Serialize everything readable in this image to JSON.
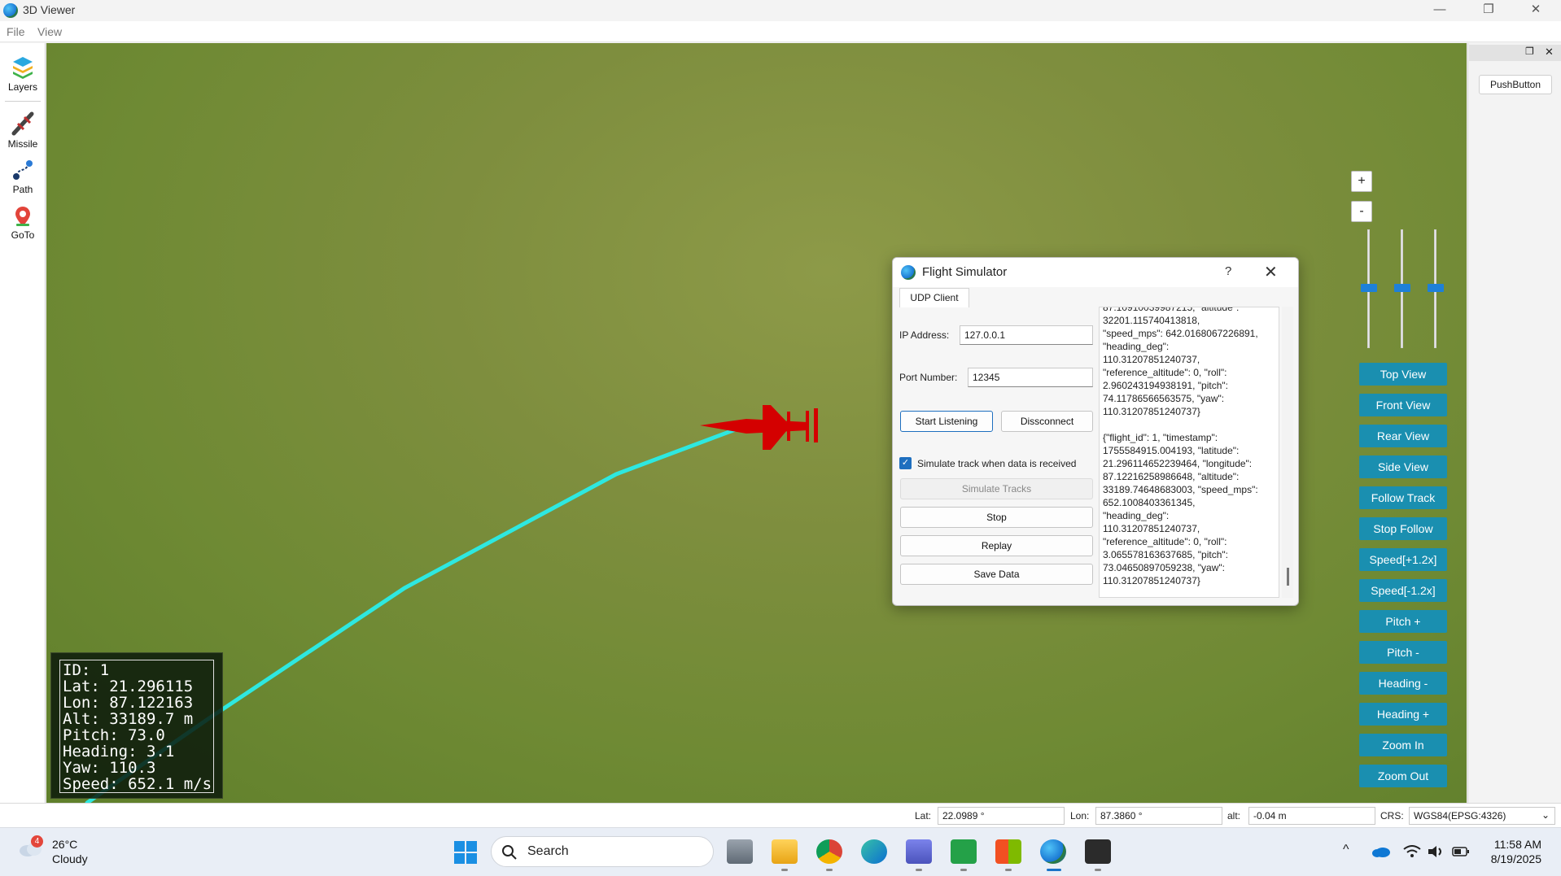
{
  "window": {
    "title": "3D Viewer",
    "minimize": "—",
    "restore": "❐",
    "close": "✕"
  },
  "menu": {
    "file": "File",
    "view": "View"
  },
  "tools": [
    {
      "label": "Layers",
      "icon": "layers-icon"
    },
    {
      "label": "Missile",
      "icon": "missile-icon"
    },
    {
      "label": "Path",
      "icon": "path-icon"
    },
    {
      "label": "GoTo",
      "icon": "goto-pin-icon"
    }
  ],
  "hud": {
    "lines": [
      "ID: 1",
      "Lat: 21.296115",
      "Lon: 87.122163",
      "Alt: 33189.7 m",
      "Pitch: 73.0",
      "Heading: 3.1",
      "Yaw: 110.3",
      "Speed: 652.1 m/s"
    ]
  },
  "dock": {
    "restore": "❐",
    "close": "✕",
    "push_button": "PushButton"
  },
  "zoom": {
    "plus": "+",
    "minus": "-"
  },
  "view_buttons": [
    "Top View",
    "Front View",
    "Rear View",
    "Side View",
    "Follow Track",
    "Stop Follow",
    "Speed[+1.2x]",
    "Speed[-1.2x]",
    "Pitch +",
    "Pitch -",
    "Heading -",
    "Heading +",
    "Zoom In",
    "Zoom Out"
  ],
  "dialog": {
    "title": "Flight Simulator",
    "help": "?",
    "close": "✕",
    "tab": "UDP Client",
    "ip_label": "IP Address:",
    "ip_value": "127.0.0.1",
    "port_label": "Port Number:",
    "port_value": "12345",
    "start_label": "Start Listening",
    "disconnect_label": "Dissconnect",
    "simulate_check_label": "Simulate track when data is received",
    "simulate_check_mark": "✓",
    "simulate_tracks_label": "Simulate Tracks",
    "stop_label": "Stop",
    "replay_label": "Replay",
    "save_label": "Save Data",
    "log_text": "87.10910039987215, \"altitude\":\n32201.115740413818,\n\"speed_mps\": 642.0168067226891,\n\"heading_deg\":\n110.31207851240737,\n\"reference_altitude\": 0, \"roll\":\n2.960243194938191, \"pitch\":\n74.11786566563575, \"yaw\":\n110.31207851240737}\n\n{\"flight_id\": 1, \"timestamp\":\n1755584915.004193, \"latitude\":\n21.296114652239464, \"longitude\":\n87.12216258986648, \"altitude\":\n33189.74648683003, \"speed_mps\":\n652.1008403361345,\n\"heading_deg\":\n110.31207851240737,\n\"reference_altitude\": 0, \"roll\":\n3.065578163637685, \"pitch\":\n73.04650897059238, \"yaw\":\n110.31207851240737}"
  },
  "status": {
    "lat_label": "Lat:",
    "lat_value": "22.0989 °",
    "lon_label": "Lon:",
    "lon_value": "87.3860 °",
    "alt_label": "alt:",
    "alt_value": "-0.04 m",
    "crs_label": "CRS:",
    "crs_value": "WGS84(EPSG:4326)",
    "crs_caret": "⌄"
  },
  "taskbar": {
    "weather_badge": "4",
    "weather_temp": "26°C",
    "weather_desc": "Cloudy",
    "search_placeholder": "Search",
    "time": "11:58 AM",
    "date": "8/19/2025",
    "tray_chevron": "^"
  },
  "colors": {
    "track": "#2ee8e0",
    "missile": "#d40000",
    "view_button": "#1a8fb0",
    "accent": "#1e6fbf"
  }
}
